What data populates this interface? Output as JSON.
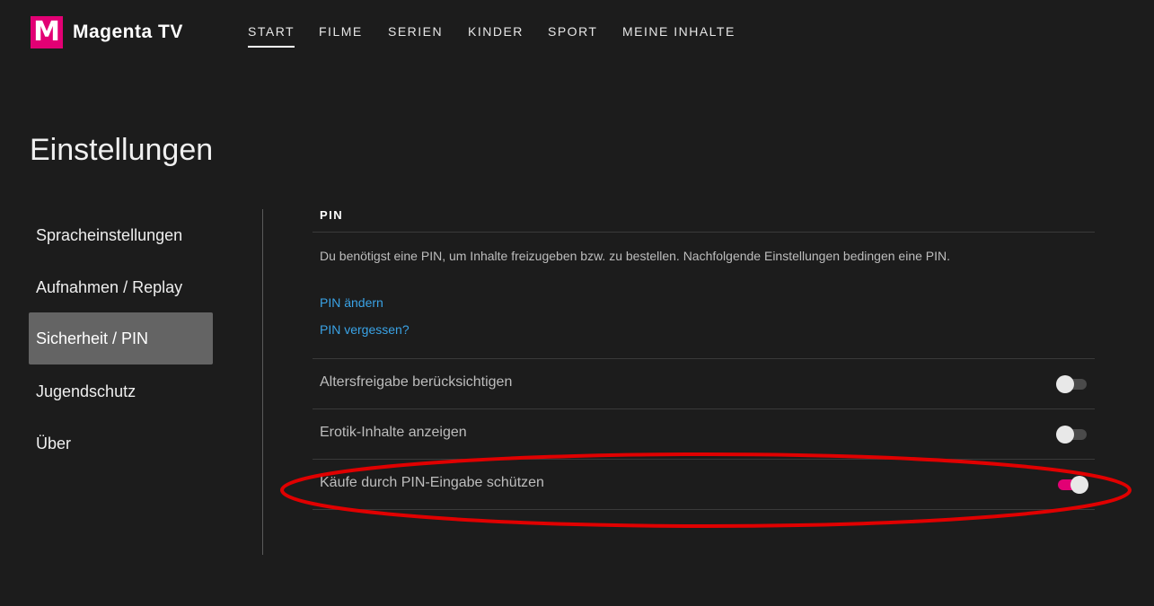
{
  "header": {
    "logo_letter": "M",
    "brand": "Magenta TV",
    "nav": [
      {
        "label": "START",
        "active": true
      },
      {
        "label": "FILME",
        "active": false
      },
      {
        "label": "SERIEN",
        "active": false
      },
      {
        "label": "KINDER",
        "active": false
      },
      {
        "label": "SPORT",
        "active": false
      },
      {
        "label": "MEINE INHALTE",
        "active": false
      }
    ]
  },
  "page_title": "Einstellungen",
  "sidebar": {
    "items": [
      {
        "label": "Spracheinstellungen",
        "selected": false
      },
      {
        "label": "Aufnahmen / Replay",
        "selected": false
      },
      {
        "label": "Sicherheit / PIN",
        "selected": true
      },
      {
        "label": "Jugendschutz",
        "selected": false
      },
      {
        "label": "Über",
        "selected": false
      }
    ]
  },
  "pin_section": {
    "title": "PIN",
    "description": "Du benötigst eine PIN, um Inhalte freizugeben bzw. zu bestellen. Nachfolgende Einstellungen bedingen eine PIN.",
    "links": [
      "PIN ändern",
      "PIN vergessen?"
    ],
    "settings": [
      {
        "label": "Altersfreigabe berücksichtigen",
        "enabled": false
      },
      {
        "label": "Erotik-Inhalte anzeigen",
        "enabled": false
      },
      {
        "label": "Käufe durch PIN-Eingabe schützen",
        "enabled": true
      }
    ]
  },
  "colors": {
    "brand_magenta": "#e20074",
    "link_blue": "#3aa3e6",
    "annotation_red": "#e00000",
    "background": "#1c1c1c"
  }
}
